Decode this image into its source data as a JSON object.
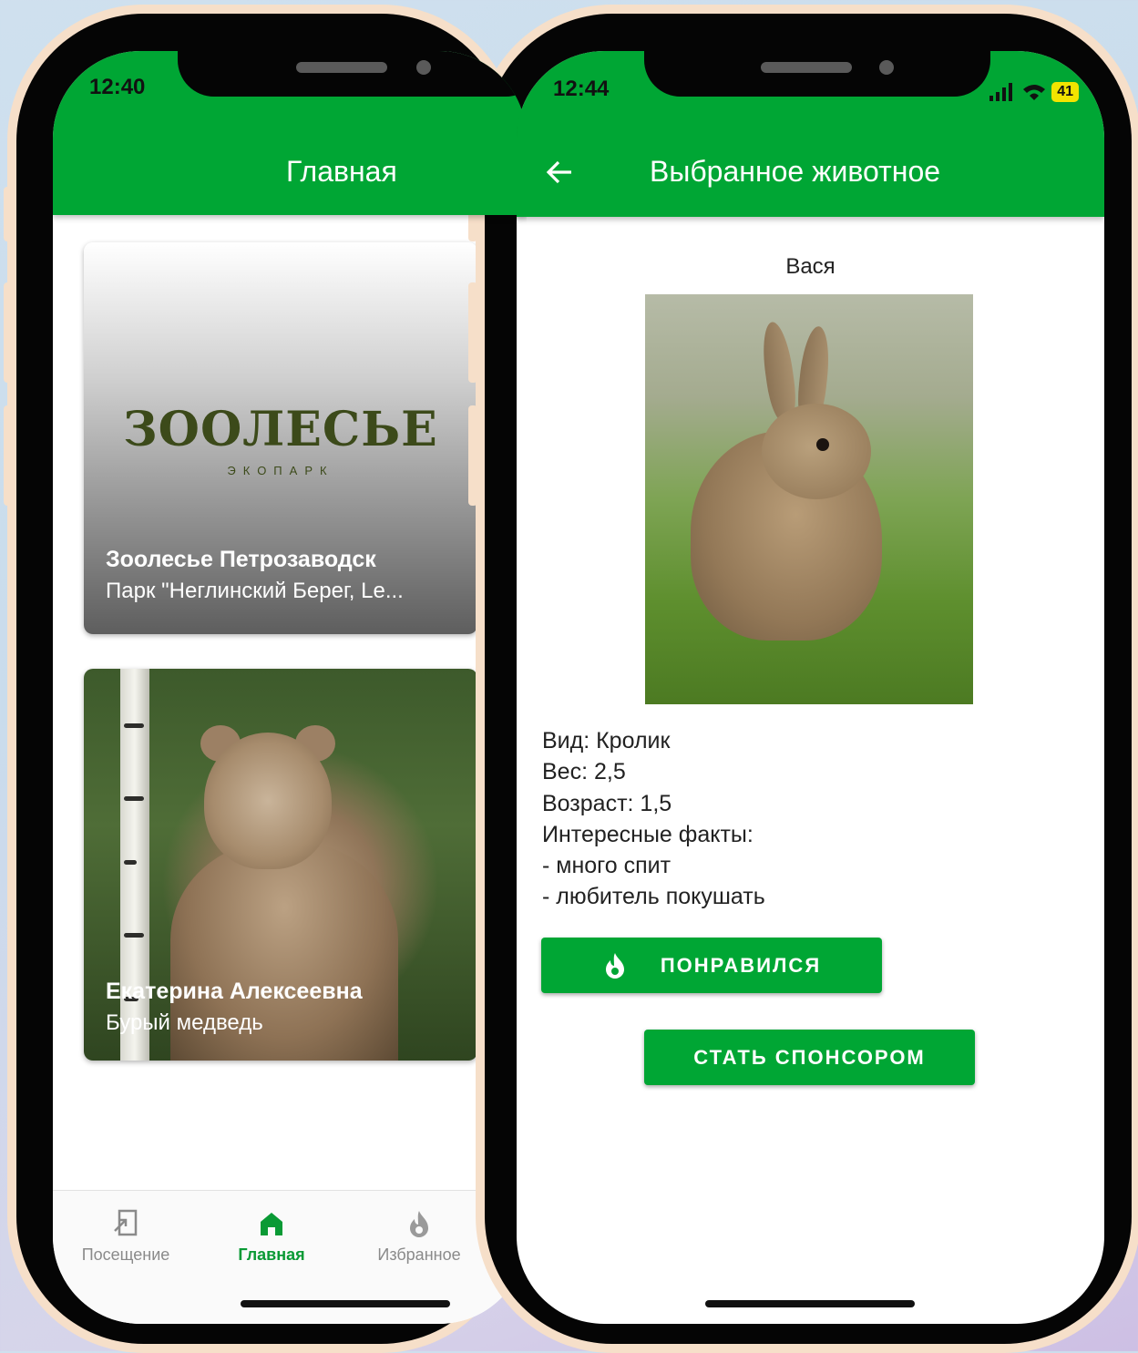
{
  "phone1": {
    "status_time": "12:40",
    "appbar_title": "Главная",
    "cards": [
      {
        "logo_text": "ЗООЛЕСЬЕ",
        "logo_sub": "ЭКОПАРК",
        "title": "Зоолесье Петрозаводск",
        "subtitle": "Парк \"Неглинский Берег, Le..."
      },
      {
        "title": "Екатерина Алексеевна",
        "subtitle": "Бурый медведь"
      }
    ],
    "bottom_nav": [
      {
        "label": "Посещение",
        "icon": "entry-icon",
        "active": false
      },
      {
        "label": "Главная",
        "icon": "home-icon",
        "active": true
      },
      {
        "label": "Избранное",
        "icon": "flame-icon",
        "active": false
      }
    ]
  },
  "phone2": {
    "status_time": "12:44",
    "battery": "41",
    "appbar_title": "Выбранное животное",
    "pet_name": "Вася",
    "info": {
      "species": "Вид: Кролик",
      "weight": "Вес: 2,5",
      "age": "Возраст: 1,5",
      "facts_label": "Интересные факты:",
      "fact1": "- много спит",
      "fact2": "- любитель покушать"
    },
    "like_button": "ПОНРАВИЛСЯ",
    "sponsor_button": "СТАТЬ СПОНСОРОМ"
  },
  "colors": {
    "accent": "#00a634",
    "frame": "#f6dfc9",
    "battery": "#f2e400"
  }
}
